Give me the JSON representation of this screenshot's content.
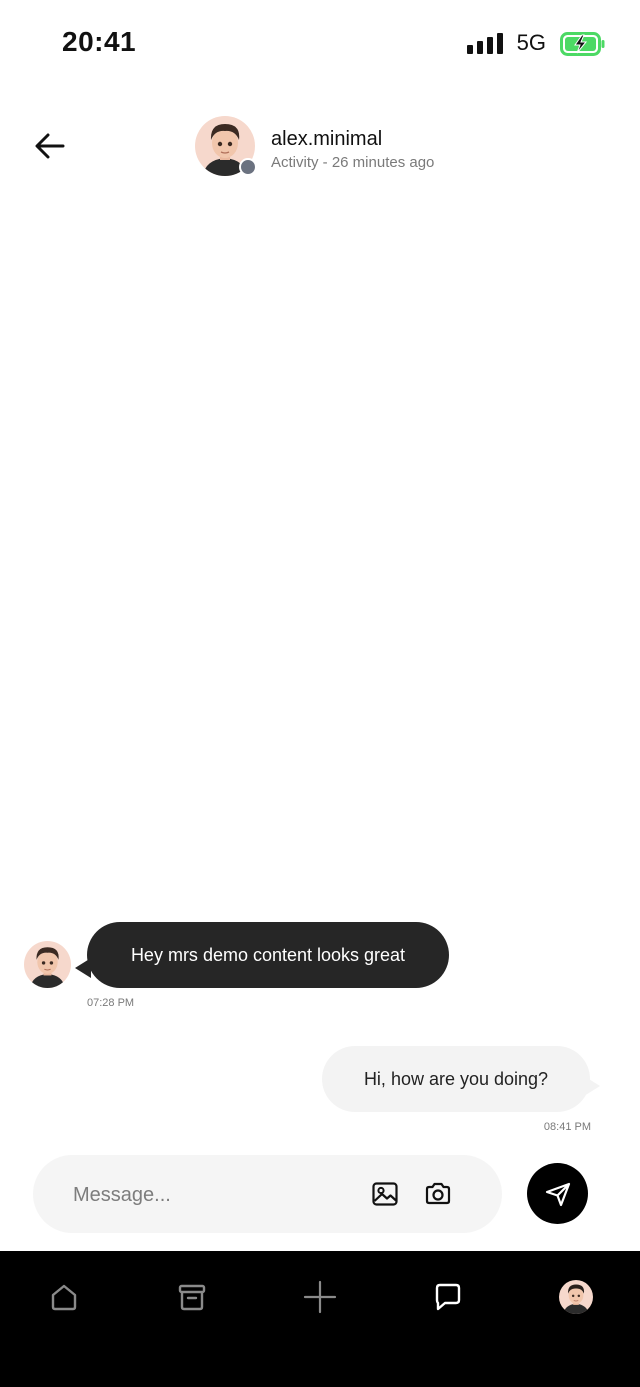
{
  "status_bar": {
    "time": "20:41",
    "network": "5G",
    "icons": [
      "signal-icon",
      "battery-charging-icon"
    ],
    "battery_color": "#4cd964"
  },
  "header": {
    "username": "alex.minimal",
    "activity": "Activity - 26 minutes ago",
    "icons": [
      "back-arrow-icon",
      "avatar"
    ],
    "presence_color": "#6b7280"
  },
  "messages": [
    {
      "direction": "incoming",
      "text": "Hey mrs demo content looks great",
      "time": "07:28 PM"
    },
    {
      "direction": "outgoing",
      "text": "Hi, how are you doing?",
      "time": "08:41 PM"
    }
  ],
  "composer": {
    "placeholder": "Message...",
    "value": "",
    "icons": [
      "image-icon",
      "camera-icon",
      "send-icon"
    ]
  },
  "bottom_nav": {
    "items": [
      "home-icon",
      "archive-icon",
      "plus-icon",
      "chat-icon",
      "profile-avatar"
    ],
    "active": "chat-icon"
  },
  "colors": {
    "incoming_bubble": "#262626",
    "outgoing_bubble": "#f3f3f3",
    "nav_background": "#000000",
    "send_button": "#000000"
  }
}
